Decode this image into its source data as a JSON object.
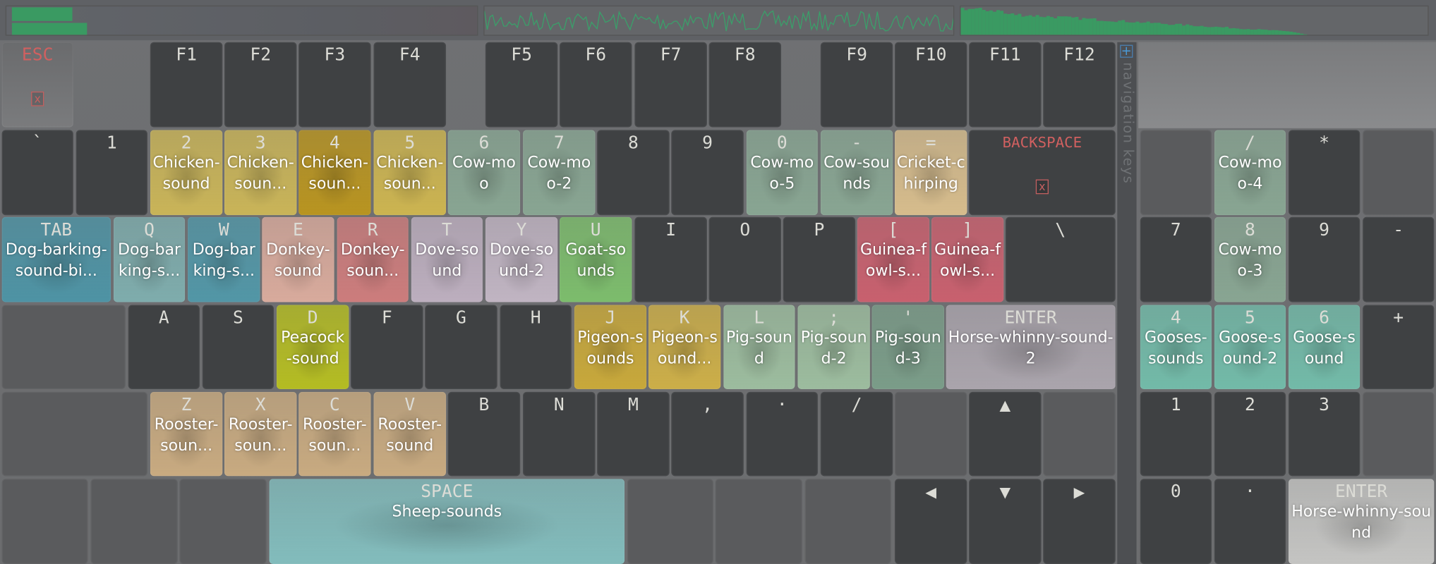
{
  "meters": {
    "level_color": "#3a9a62",
    "wave_color": "#3aa06a",
    "spectrum_color": "#3a9a62"
  },
  "nav_panel": {
    "label": "navigation keys",
    "expand_icon": "plus-icon"
  },
  "rows": [
    [
      {
        "label": "ESC",
        "label_color": "#d06060",
        "disabled_icon": true,
        "style": "bg"
      },
      {
        "label": "F1"
      },
      {
        "label": "F2"
      },
      {
        "label": "F3"
      },
      {
        "label": "F4"
      },
      {
        "label": "F5"
      },
      {
        "label": "F6"
      },
      {
        "label": "F7"
      },
      {
        "label": "F8"
      },
      {
        "label": "F9"
      },
      {
        "label": "F10"
      },
      {
        "label": "F11"
      },
      {
        "label": "F12"
      }
    ],
    [
      {
        "label": "`"
      },
      {
        "label": "1"
      },
      {
        "label": "2",
        "sound": "Chicken-sound",
        "color": "#c9b458"
      },
      {
        "label": "3",
        "sound": "Chicken-soun...",
        "color": "#c9b458"
      },
      {
        "label": "4",
        "sound": "Chicken-soun...",
        "color": "#b89420"
      },
      {
        "label": "5",
        "sound": "Chicken-soun...",
        "color": "#ccb450"
      },
      {
        "label": "6",
        "sound": "Cow-moo",
        "color": "#88a592"
      },
      {
        "label": "7",
        "sound": "Cow-moo-2",
        "color": "#88a592"
      },
      {
        "label": "8"
      },
      {
        "label": "9"
      },
      {
        "label": "0",
        "sound": "Cow-moo-5",
        "color": "#88a592"
      },
      {
        "label": "-",
        "sound": "Cow-sounds",
        "color": "#88a592"
      },
      {
        "label": "=",
        "sound": "Cricket-chirping",
        "color": "#d6bc8c"
      },
      {
        "label": "BACKSPACE",
        "label_color": "#d06060",
        "disabled_icon": true,
        "style": "backspace"
      },
      {
        "label": "",
        "style": "blank"
      },
      {
        "label": "/",
        "sound": "Cow-moo-4",
        "color": "#88a592"
      },
      {
        "label": "*"
      },
      {
        "label": "",
        "style": "blank"
      }
    ],
    [
      {
        "label": "TAB",
        "sound": "Dog-barking-sound-bi...",
        "color": "#4e93a4"
      },
      {
        "label": "Q",
        "sound": "Dog-barking-s...",
        "color": "#7eacac"
      },
      {
        "label": "W",
        "sound": "Dog-barking-s...",
        "color": "#5296a6"
      },
      {
        "label": "E",
        "sound": "Donkey-sound",
        "color": "#d8aa9c"
      },
      {
        "label": "R",
        "sound": "Donkey-soun...",
        "color": "#cc7c7c"
      },
      {
        "label": "T",
        "sound": "Dove-sound",
        "color": "#bcaebe"
      },
      {
        "label": "Y",
        "sound": "Dove-sound-2",
        "color": "#c0b4c2"
      },
      {
        "label": "U",
        "sound": "Goat-sounds",
        "color": "#7cbc6c"
      },
      {
        "label": "I"
      },
      {
        "label": "O"
      },
      {
        "label": "P"
      },
      {
        "label": "[",
        "sound": "Guinea-fowl-s...",
        "color": "#c8606e"
      },
      {
        "label": "]",
        "sound": "Guinea-fowl-s...",
        "color": "#c8606e"
      },
      {
        "label": "\\"
      },
      {
        "label": "7"
      },
      {
        "label": "8",
        "sound": "Cow-moo-3",
        "color": "#88a592"
      },
      {
        "label": "9"
      },
      {
        "label": "-"
      }
    ],
    [
      {
        "label": "",
        "style": "blank"
      },
      {
        "label": "A"
      },
      {
        "label": "S"
      },
      {
        "label": "D",
        "sound": "Peacock-sound",
        "color": "#b4bc22"
      },
      {
        "label": "F"
      },
      {
        "label": "G"
      },
      {
        "label": "H"
      },
      {
        "label": "J",
        "sound": "Pigeon-sounds",
        "color": "#c8a83a"
      },
      {
        "label": "K",
        "sound": "Pigeon-sound...",
        "color": "#ccae48"
      },
      {
        "label": "L",
        "sound": "Pig-sound",
        "color": "#9cbc9e"
      },
      {
        "label": ";",
        "sound": "Pig-sound-2",
        "color": "#9cbc9e"
      },
      {
        "label": "'",
        "sound": "Pig-sound-3",
        "color": "#7a9c88"
      },
      {
        "label": "ENTER",
        "sound": "Horse-whinny-sound-2",
        "color": "#aaa4ac"
      },
      {
        "label": "4",
        "sound": "Gooses-sounds",
        "color": "#72baa8"
      },
      {
        "label": "5",
        "sound": "Goose-sound-2",
        "color": "#72baa8"
      },
      {
        "label": "6",
        "sound": "Goose-sound",
        "color": "#72baa8"
      },
      {
        "label": "+"
      }
    ],
    [
      {
        "label": "",
        "style": "blank"
      },
      {
        "label": "Z",
        "sound": "Rooster-soun...",
        "color": "#c8aa80"
      },
      {
        "label": "X",
        "sound": "Rooster-soun...",
        "color": "#c8aa80"
      },
      {
        "label": "C",
        "sound": "Rooster-soun...",
        "color": "#c8aa80"
      },
      {
        "label": "V",
        "sound": "Rooster-sound",
        "color": "#c8aa80"
      },
      {
        "label": "B"
      },
      {
        "label": "N"
      },
      {
        "label": "M"
      },
      {
        "label": ","
      },
      {
        "label": "·"
      },
      {
        "label": "/"
      },
      {
        "label": "",
        "style": "blank"
      },
      {
        "label": "▲"
      },
      {
        "label": "",
        "style": "blank"
      },
      {
        "label": "1"
      },
      {
        "label": "2"
      },
      {
        "label": "3"
      },
      {
        "label": "",
        "style": "blank"
      }
    ],
    [
      {
        "label": "",
        "style": "blank"
      },
      {
        "label": "",
        "style": "blank"
      },
      {
        "label": "",
        "style": "blank"
      },
      {
        "label": "SPACE",
        "sound": "Sheep-sounds",
        "color": "#82bcbc"
      },
      {
        "label": "",
        "style": "blank"
      },
      {
        "label": "",
        "style": "blank"
      },
      {
        "label": "",
        "style": "blank"
      },
      {
        "label": "◀"
      },
      {
        "label": "▼"
      },
      {
        "label": "▶"
      },
      {
        "label": "0"
      },
      {
        "label": "·"
      },
      {
        "label": "ENTER",
        "sound": "Horse-whinny-sound",
        "color": "#c4c4c2"
      }
    ]
  ]
}
